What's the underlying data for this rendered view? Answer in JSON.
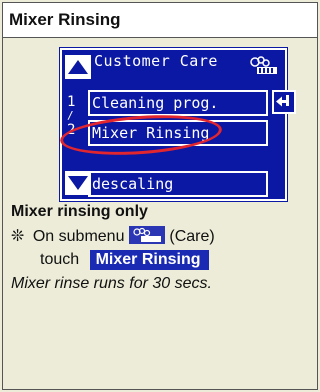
{
  "page": {
    "title": "Mixer Rinsing"
  },
  "screen": {
    "header_title": "Customer Care",
    "menu_items": [
      {
        "number": "1",
        "label": "Cleaning prog."
      },
      {
        "number": "2",
        "label": "Mixer Rinsing"
      },
      {
        "number": "",
        "label": "descaling"
      }
    ],
    "num_separator": "/"
  },
  "instructions": {
    "heading": "Mixer rinsing only",
    "bullet_glyph": "❊",
    "line1_before": "On submenu",
    "line1_after": "(Care)",
    "line2_before": "touch",
    "button_label": "Mixer Rinsing",
    "note": "Mixer rinse runs for 30 secs."
  },
  "colors": {
    "screen_bg": "#0b18a3",
    "highlight": "#e2262f",
    "background": "#ececd8"
  },
  "icons": {
    "up": "arrow-up-icon",
    "down": "arrow-down-icon",
    "back": "return-icon",
    "care": "coffee-care-icon"
  }
}
